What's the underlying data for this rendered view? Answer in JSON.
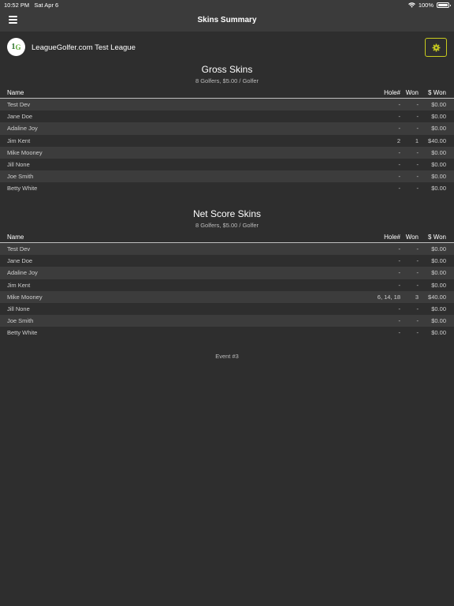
{
  "status_bar": {
    "time": "10:52 PM",
    "date": "Sat Apr 6",
    "battery": "100%"
  },
  "header": {
    "title": "Skins Summary",
    "menu_icon": "hamburger-icon"
  },
  "league": {
    "name": "LeagueGolfer.com Test League",
    "logo_text": "1",
    "logo_letter": "G",
    "settings_icon": "gear-icon"
  },
  "colors": {
    "accent": "#c9cc1e",
    "background": "#2e2e2e",
    "header": "#3b3b3b"
  },
  "gross": {
    "title": "Gross Skins",
    "subtitle": "8  Golfers, $5.00 / Golfer",
    "columns": {
      "name": "Name",
      "hole": "Hole#",
      "won": "Won",
      "amount": "$ Won"
    },
    "rows": [
      {
        "name": "Test Dev",
        "hole": "-",
        "won": "-",
        "amount": "$0.00"
      },
      {
        "name": "Jane Doe",
        "hole": "-",
        "won": "-",
        "amount": "$0.00"
      },
      {
        "name": "Adaline Joy",
        "hole": "-",
        "won": "-",
        "amount": "$0.00"
      },
      {
        "name": "Jim Kent",
        "hole": "2",
        "won": "1",
        "amount": "$40.00"
      },
      {
        "name": "Mike Mooney",
        "hole": "-",
        "won": "-",
        "amount": "$0.00"
      },
      {
        "name": "Jill None",
        "hole": "-",
        "won": "-",
        "amount": "$0.00"
      },
      {
        "name": "Joe Smith",
        "hole": "-",
        "won": "-",
        "amount": "$0.00"
      },
      {
        "name": "Betty White",
        "hole": "-",
        "won": "-",
        "amount": "$0.00"
      }
    ]
  },
  "net": {
    "title": "Net Score Skins",
    "subtitle": "8 Golfers, $5.00 / Golfer",
    "columns": {
      "name": "Name",
      "hole": "Hole#",
      "won": "Won",
      "amount": "$ Won"
    },
    "rows": [
      {
        "name": "Test Dev",
        "hole": "-",
        "won": "-",
        "amount": "$0.00"
      },
      {
        "name": "Jane Doe",
        "hole": "-",
        "won": "-",
        "amount": "$0.00"
      },
      {
        "name": "Adaline Joy",
        "hole": "-",
        "won": "-",
        "amount": "$0.00"
      },
      {
        "name": "Jim Kent",
        "hole": "-",
        "won": "-",
        "amount": "$0.00"
      },
      {
        "name": "Mike Mooney",
        "hole": "6, 14, 18",
        "won": "3",
        "amount": "$40.00"
      },
      {
        "name": "Jill None",
        "hole": "-",
        "won": "-",
        "amount": "$0.00"
      },
      {
        "name": "Joe Smith",
        "hole": "-",
        "won": "-",
        "amount": "$0.00"
      },
      {
        "name": "Betty White",
        "hole": "-",
        "won": "-",
        "amount": "$0.00"
      }
    ]
  },
  "footer": {
    "event": "Event #3"
  }
}
